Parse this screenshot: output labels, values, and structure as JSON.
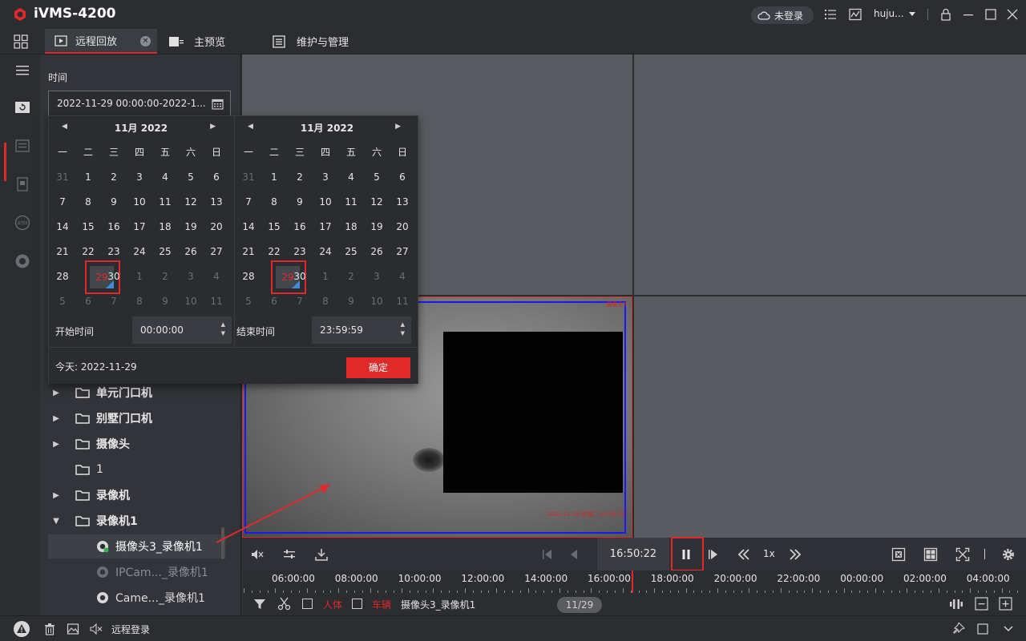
{
  "app": {
    "title": "iVMS-4200"
  },
  "titlebar": {
    "login_status": "未登录",
    "username": "huju..."
  },
  "tabs": [
    {
      "label": "远程回放",
      "active": true
    },
    {
      "label": "主预览",
      "active": false
    },
    {
      "label": "维护与管理",
      "active": false
    }
  ],
  "left_panel": {
    "time_label": "时间",
    "time_range_value": "2022-11-29 00:00:00-2022-1...",
    "tree": [
      {
        "label": "单元门口机",
        "expandable": true
      },
      {
        "label": "别墅门口机",
        "expandable": true
      },
      {
        "label": "摄像头",
        "expandable": true
      },
      {
        "label": "1",
        "expandable": false
      },
      {
        "label": "录像机",
        "expandable": true
      },
      {
        "label": "录像机1",
        "expanded": true
      }
    ],
    "cameras": [
      {
        "label": "摄像头3_录像机1",
        "selected": true
      },
      {
        "label": "IPCam..._录像机1",
        "dim": true
      },
      {
        "label": "Came..._录像机1",
        "dim": false
      }
    ]
  },
  "calendar": {
    "left": {
      "header": "11月  2022"
    },
    "right": {
      "header": "11月  2022"
    },
    "weekdays": [
      "一",
      "二",
      "三",
      "四",
      "五",
      "六",
      "日"
    ],
    "days": [
      [
        "31",
        "1",
        "2",
        "3",
        "4",
        "5",
        "6"
      ],
      [
        "7",
        "8",
        "9",
        "10",
        "11",
        "12",
        "13"
      ],
      [
        "14",
        "15",
        "16",
        "17",
        "18",
        "19",
        "20"
      ],
      [
        "21",
        "22",
        "23",
        "24",
        "25",
        "26",
        "27"
      ],
      [
        "28",
        "29",
        "30",
        "1",
        "2",
        "3",
        "4"
      ],
      [
        "5",
        "6",
        "7",
        "8",
        "9",
        "10",
        "11"
      ]
    ],
    "selected_day": "29",
    "start_label": "开始时间",
    "start_time": "00:00:00",
    "end_label": "结束时间",
    "end_time": "23:59:59",
    "today_label": "今天: 2022-11-29",
    "ok_label": "确定"
  },
  "video": {
    "osd_camera_name": "摄像头3",
    "osd_timestamp": "2022-11-29 星期二 16:50:23"
  },
  "controls": {
    "current_time": "16:50:22",
    "speed": "1x"
  },
  "timeline": {
    "ticks": [
      "06:00:00",
      "08:00:00",
      "10:00:00",
      "12:00:00",
      "14:00:00",
      "16:00:00",
      "18:00:00",
      "20:00:00",
      "22:00:00",
      "00:00:00",
      "02:00:00",
      "04:00:00"
    ]
  },
  "filter_bar": {
    "human_label": "人体",
    "vehicle_label": "车辆",
    "camera_name": "摄像头3_录像机1",
    "page_indicator": "11/29"
  },
  "status_bar": {
    "remote_login": "远程登录"
  },
  "colors": {
    "accent_red": "#e02a2a",
    "calendar_marker_blue": "#3d8ed8",
    "background": "#2b2d31"
  }
}
